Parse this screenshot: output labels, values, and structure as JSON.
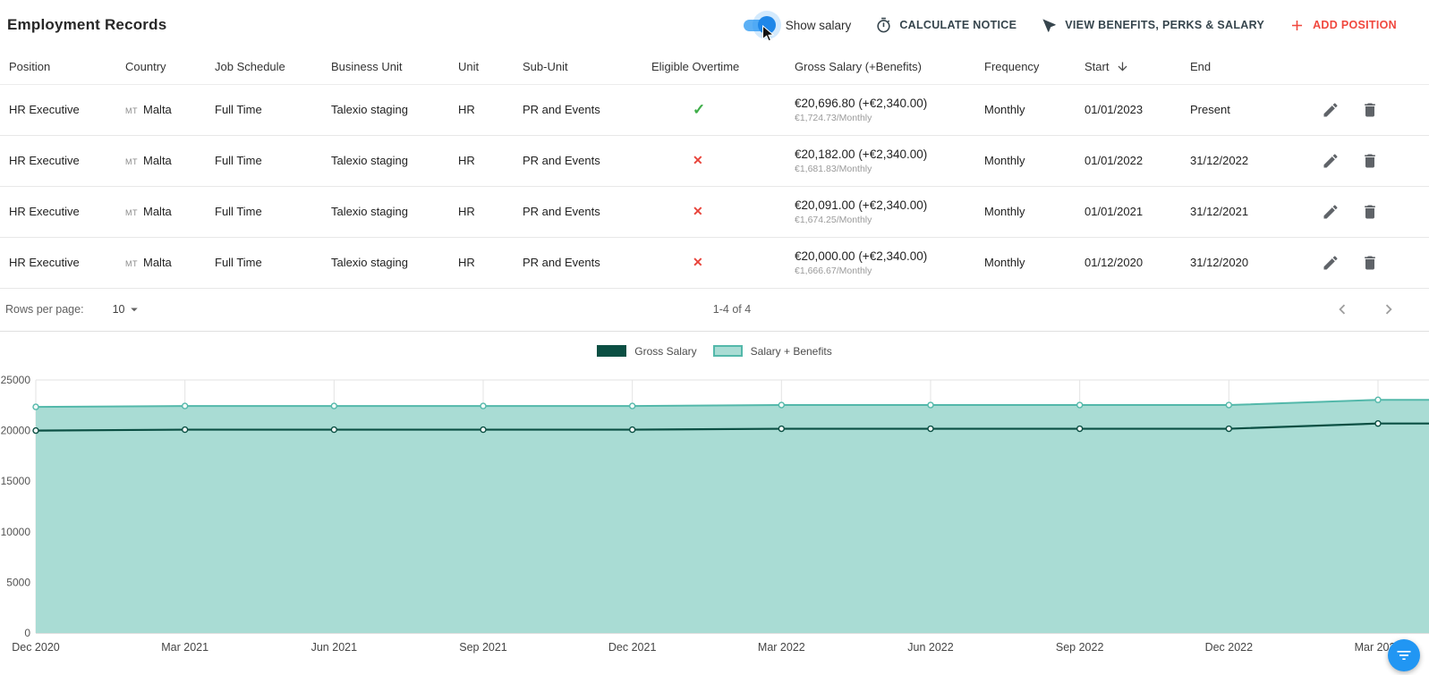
{
  "header": {
    "title": "Employment Records",
    "show_salary_label": "Show salary",
    "show_salary_on": true,
    "accent_blue": "#2196f3",
    "actions": [
      {
        "label": "CALCULATE NOTICE",
        "icon": "timer-icon"
      },
      {
        "label": "VIEW BENEFITS, PERKS & SALARY",
        "icon": "near-me-icon"
      },
      {
        "label": "ADD POSITION",
        "icon": "plus-icon",
        "color": "#f0483e"
      }
    ]
  },
  "table": {
    "columns": [
      "Position",
      "Country",
      "Job Schedule",
      "Business Unit",
      "Unit",
      "Sub-Unit",
      "Eligible Overtime",
      "Gross Salary (+Benefits)",
      "Frequency",
      "Start",
      "End",
      ""
    ],
    "sorted_by": "Start",
    "sort_direction": "desc",
    "check_green": "#3fae49",
    "cross_red": "#e8453c",
    "rows": [
      {
        "position": "HR Executive",
        "country_code": "MT",
        "country": "Malta",
        "job_schedule": "Full Time",
        "business_unit": "Talexio staging",
        "unit": "HR",
        "sub_unit": "PR and Events",
        "eligible_overtime": true,
        "gross_salary": "€20,696.80 (+€2,340.00)",
        "salary_monthly": "€1,724.73/Monthly",
        "frequency": "Monthly",
        "start": "01/01/2023",
        "end": "Present"
      },
      {
        "position": "HR Executive",
        "country_code": "MT",
        "country": "Malta",
        "job_schedule": "Full Time",
        "business_unit": "Talexio staging",
        "unit": "HR",
        "sub_unit": "PR and Events",
        "eligible_overtime": false,
        "gross_salary": "€20,182.00 (+€2,340.00)",
        "salary_monthly": "€1,681.83/Monthly",
        "frequency": "Monthly",
        "start": "01/01/2022",
        "end": "31/12/2022"
      },
      {
        "position": "HR Executive",
        "country_code": "MT",
        "country": "Malta",
        "job_schedule": "Full Time",
        "business_unit": "Talexio staging",
        "unit": "HR",
        "sub_unit": "PR and Events",
        "eligible_overtime": false,
        "gross_salary": "€20,091.00 (+€2,340.00)",
        "salary_monthly": "€1,674.25/Monthly",
        "frequency": "Monthly",
        "start": "01/01/2021",
        "end": "31/12/2021"
      },
      {
        "position": "HR Executive",
        "country_code": "MT",
        "country": "Malta",
        "job_schedule": "Full Time",
        "business_unit": "Talexio staging",
        "unit": "HR",
        "sub_unit": "PR and Events",
        "eligible_overtime": false,
        "gross_salary": "€20,000.00 (+€2,340.00)",
        "salary_monthly": "€1,666.67/Monthly",
        "frequency": "Monthly",
        "start": "01/12/2020",
        "end": "31/12/2020"
      }
    ]
  },
  "pagination": {
    "rows_per_page_label": "Rows per page:",
    "rows_per_page": "10",
    "range_label": "1-4 of 4"
  },
  "chart_data": {
    "type": "area",
    "x": [
      "Dec 2020",
      "Mar 2021",
      "Jun 2021",
      "Sep 2021",
      "Dec 2021",
      "Mar 2022",
      "Jun 2022",
      "Sep 2022",
      "Dec 2022",
      "Mar 2023"
    ],
    "series": [
      {
        "name": "Gross Salary",
        "color": "#0b4f43",
        "values": [
          20000,
          20091,
          20091,
          20091,
          20091,
          20182,
          20182,
          20182,
          20182,
          20696.8
        ]
      },
      {
        "name": "Salary + Benefits",
        "color": "#53b8aa",
        "fill": "#a9dcd4",
        "values": [
          22340,
          22431,
          22431,
          22431,
          22431,
          22522,
          22522,
          22522,
          22522,
          23036.8
        ]
      }
    ],
    "ylim": [
      0,
      25000
    ],
    "yticks": [
      0,
      5000,
      10000,
      15000,
      20000,
      25000
    ],
    "grid": true,
    "legend_position": "top"
  },
  "fab": {
    "icon": "filter-list-icon",
    "color": "#2196f3"
  }
}
